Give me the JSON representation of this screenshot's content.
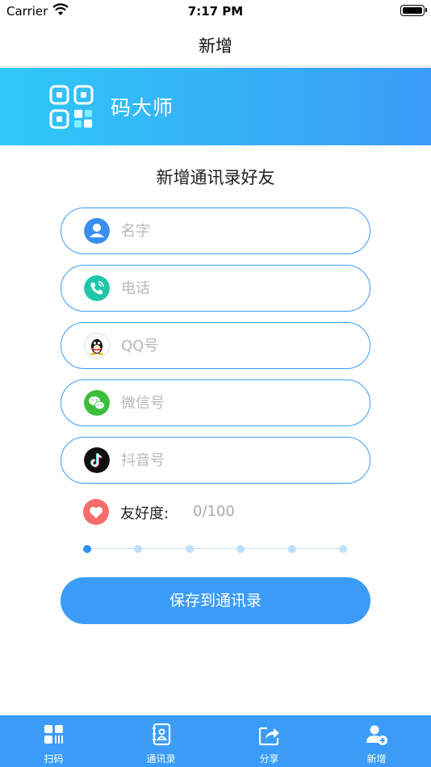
{
  "status_bar": {
    "carrier": "Carrier",
    "time": "7:17 PM"
  },
  "nav": {
    "title": "新增"
  },
  "banner": {
    "brand": "码大师"
  },
  "form": {
    "title": "新增通讯录好友",
    "fields": [
      {
        "placeholder": "名字",
        "icon": "user-icon",
        "value": ""
      },
      {
        "placeholder": "电话",
        "icon": "phone-icon",
        "value": ""
      },
      {
        "placeholder": "QQ号",
        "icon": "qq-icon",
        "value": ""
      },
      {
        "placeholder": "微信号",
        "icon": "wechat-icon",
        "value": ""
      },
      {
        "placeholder": "抖音号",
        "icon": "tiktok-icon",
        "value": ""
      }
    ],
    "friendship": {
      "label": "友好度:",
      "value": "0/100",
      "level": 0,
      "steps": 6
    },
    "save_label": "保存到通讯录"
  },
  "tabs": [
    {
      "label": "扫码",
      "icon": "scan-icon"
    },
    {
      "label": "通讯录",
      "icon": "contacts-book-icon"
    },
    {
      "label": "分享",
      "icon": "share-icon"
    },
    {
      "label": "新增",
      "icon": "add-user-icon"
    }
  ],
  "colors": {
    "accent": "#3a9cf6",
    "banner_start": "#2fc8f7",
    "heart": "#f76b6b"
  }
}
